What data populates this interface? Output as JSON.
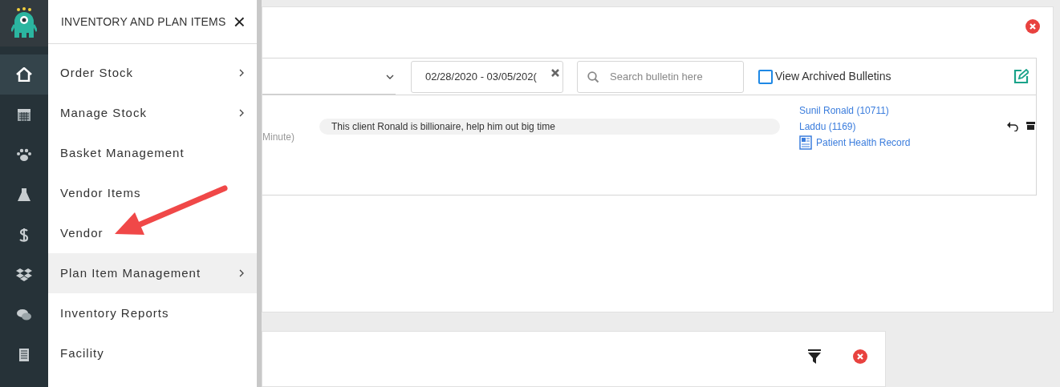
{
  "sidebar": {
    "items": [
      {
        "selected": true
      },
      {
        "selected": false
      },
      {
        "selected": false
      },
      {
        "selected": false
      },
      {
        "selected": false
      },
      {
        "selected": false
      },
      {
        "selected": false
      },
      {
        "selected": false
      }
    ]
  },
  "menu": {
    "title": "INVENTORY AND PLAN ITEMS",
    "close": "×",
    "items": [
      {
        "label": "Order Stock",
        "submenu": true,
        "hovered": false
      },
      {
        "label": "Manage Stock",
        "submenu": true,
        "hovered": false
      },
      {
        "label": "Basket Management",
        "submenu": false,
        "hovered": false
      },
      {
        "label": "Vendor Items",
        "submenu": false,
        "hovered": false
      },
      {
        "label": "Vendor",
        "submenu": false,
        "hovered": false
      },
      {
        "label": "Plan Item Management",
        "submenu": true,
        "hovered": true
      },
      {
        "label": "Inventory Reports",
        "submenu": false,
        "hovered": false
      },
      {
        "label": "Facility",
        "submenu": false,
        "hovered": false
      }
    ]
  },
  "bulletins": {
    "date_range": "02/28/2020 - 03/05/202(",
    "search": {
      "placeholder": "Search bulletin here"
    },
    "archived": {
      "label": "View Archived Bulletins",
      "checked": false
    },
    "rows": [
      {
        "time": "Minute)",
        "message": "This client Ronald is billionaire, help him out big time",
        "links": [
          "Sunil Ronald (10711)",
          "Laddu (1169)",
          "Patient Health Record"
        ]
      }
    ]
  }
}
